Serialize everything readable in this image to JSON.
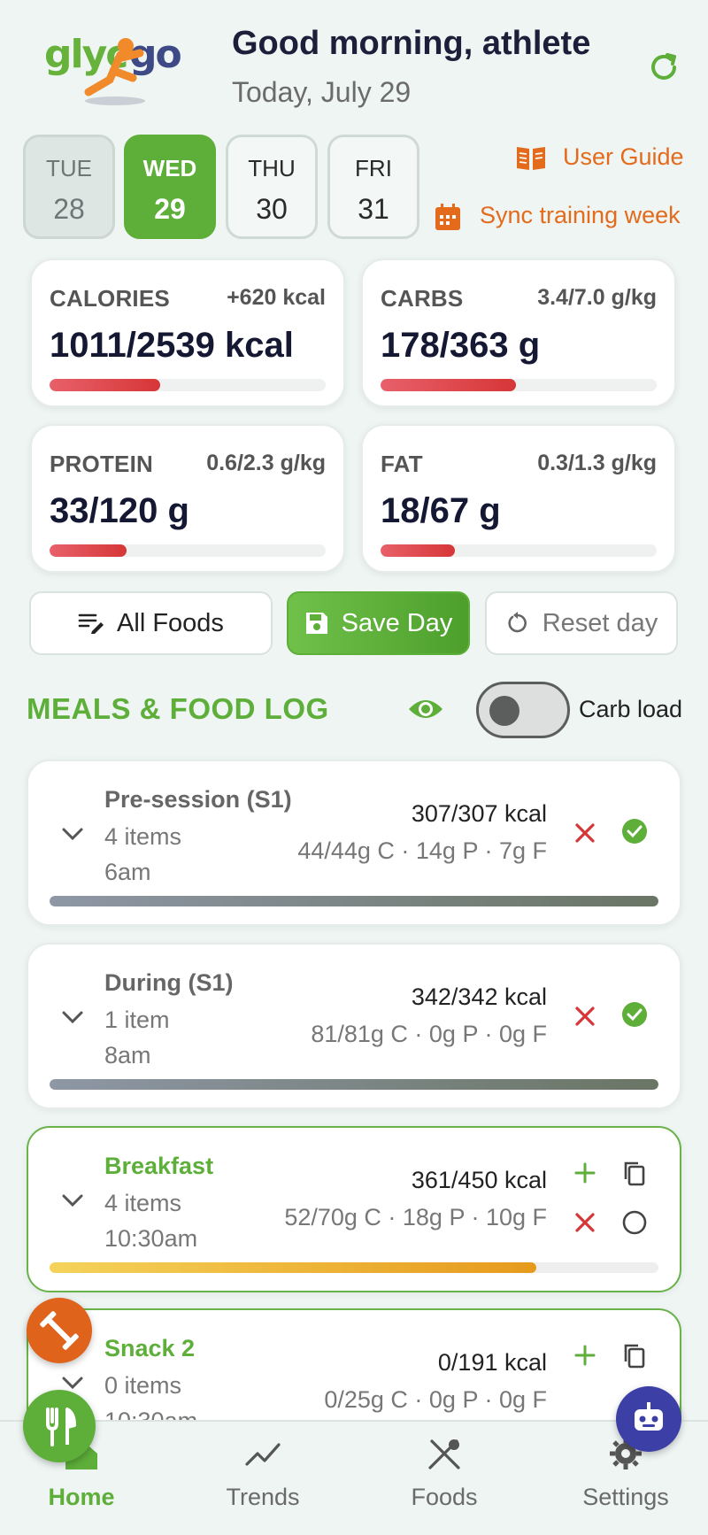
{
  "header": {
    "logo_text": "glycogo",
    "greeting": "Good morning, athlete",
    "date": "Today, July 29"
  },
  "days": [
    {
      "name": "TUE",
      "num": "28",
      "state": "past"
    },
    {
      "name": "WED",
      "num": "29",
      "state": "active"
    },
    {
      "name": "THU",
      "num": "30",
      "state": "future"
    },
    {
      "name": "FRI",
      "num": "31",
      "state": "future"
    }
  ],
  "links": {
    "user_guide": "User Guide",
    "sync": "Sync training week"
  },
  "stats": {
    "calories": {
      "label": "CALORIES",
      "ratio": "+620 kcal",
      "value": "1011/2539 kcal",
      "progress": 0.4
    },
    "carbs": {
      "label": "CARBS",
      "ratio": "3.4/7.0 g/kg",
      "value": "178/363 g",
      "progress": 0.49
    },
    "protein": {
      "label": "PROTEIN",
      "ratio": "0.6/2.3 g/kg",
      "value": "33/120 g",
      "progress": 0.28
    },
    "fat": {
      "label": "FAT",
      "ratio": "0.3/1.3 g/kg",
      "value": "18/67 g",
      "progress": 0.27
    }
  },
  "actions": {
    "all_foods": "All Foods",
    "save_day": "Save Day",
    "reset_day": "Reset day"
  },
  "meals_section": {
    "title": "MEALS & FOOD LOG",
    "carb_load_label": "Carb load",
    "carb_load_on": false
  },
  "meals": [
    {
      "name": "Pre-session (S1)",
      "items": "4 items",
      "time": "6am",
      "kcal": "307/307 kcal",
      "macros": "44/44g C · 14g P · 7g F",
      "progress": 1.0,
      "status": "done"
    },
    {
      "name": "During (S1)",
      "items": "1 item",
      "time": "8am",
      "kcal": "342/342 kcal",
      "macros": "81/81g C · 0g P · 0g F",
      "progress": 1.0,
      "status": "done"
    },
    {
      "name": "Breakfast",
      "items": "4 items",
      "time": "10:30am",
      "kcal": "361/450 kcal",
      "macros": "52/70g C · 18g P · 10g F",
      "progress": 0.8,
      "status": "open"
    },
    {
      "name": "Snack 2",
      "items": "0 items",
      "time": "10:30am",
      "kcal": "0/191 kcal",
      "macros": "0/25g C · 0g P · 0g F",
      "progress": 0,
      "status": "open"
    }
  ],
  "nav": {
    "home": "Home",
    "trends": "Trends",
    "foods": "Foods",
    "settings": "Settings"
  },
  "colors": {
    "brand_green": "#5eae3a",
    "accent_orange": "#e46a1c",
    "bot_blue": "#3b3fa6",
    "progress_red": "#d63637"
  }
}
